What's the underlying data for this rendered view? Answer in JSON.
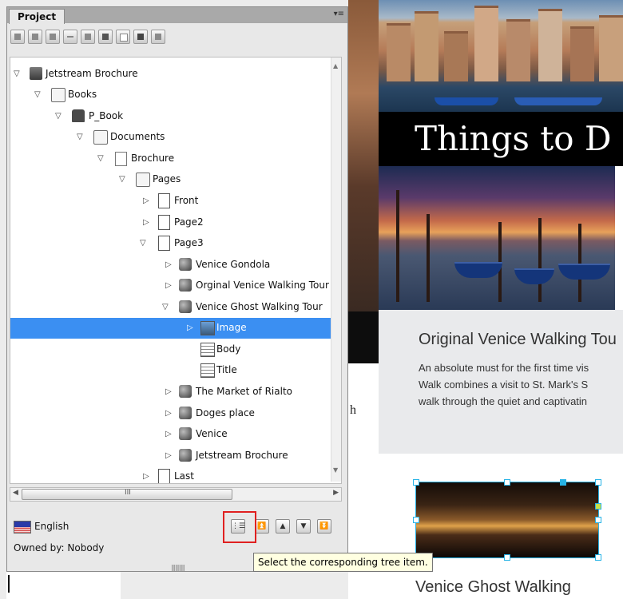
{
  "panel": {
    "tab_label": "Project",
    "menu_icon": "panel-menu-icon"
  },
  "toolbar": {
    "icons": [
      "file-icon",
      "save-icon",
      "checklist-icon",
      "add-icon",
      "copy-icon",
      "delete-icon",
      "blank-page-icon",
      "image-panel-icon",
      "settings-icon"
    ]
  },
  "tree": {
    "items": [
      {
        "label": "Jetstream Brochure",
        "icon": "book-icon",
        "toggle": "expanded"
      },
      {
        "label": "Books",
        "icon": "folder-icon",
        "toggle": "expanded"
      },
      {
        "label": "P_Book",
        "icon": "publication-book-icon",
        "toggle": "expanded"
      },
      {
        "label": "Documents",
        "icon": "folder-icon",
        "toggle": "expanded"
      },
      {
        "label": "Brochure",
        "icon": "document-icon",
        "toggle": "expanded"
      },
      {
        "label": "Pages",
        "icon": "folder-icon",
        "toggle": "expanded"
      },
      {
        "label": "Front",
        "icon": "page-icon",
        "toggle": "collapsed"
      },
      {
        "label": "Page2",
        "icon": "page-icon",
        "toggle": "collapsed"
      },
      {
        "label": "Page3",
        "icon": "page-icon",
        "toggle": "expanded"
      },
      {
        "label": "Venice Gondola",
        "icon": "component-icon",
        "toggle": "collapsed"
      },
      {
        "label": "Orginal Venice Walking Tour",
        "icon": "component-icon",
        "toggle": "collapsed"
      },
      {
        "label": "Venice Ghost Walking Tour",
        "icon": "component-icon",
        "toggle": "expanded"
      },
      {
        "label": "Image",
        "icon": "image-frame-icon",
        "toggle": "collapsed",
        "selected": true
      },
      {
        "label": "Body",
        "icon": "text-frame-icon",
        "toggle": "none"
      },
      {
        "label": "Title",
        "icon": "text-frame-icon",
        "toggle": "none"
      },
      {
        "label": "The Market of Rialto",
        "icon": "component-icon",
        "toggle": "collapsed"
      },
      {
        "label": "Doges place",
        "icon": "component-icon",
        "toggle": "collapsed"
      },
      {
        "label": "Venice",
        "icon": "component-icon",
        "toggle": "collapsed"
      },
      {
        "label": "Jetstream Brochure",
        "icon": "component-icon",
        "toggle": "collapsed"
      },
      {
        "label": "Last",
        "icon": "page-icon",
        "toggle": "collapsed"
      }
    ]
  },
  "scrollbar": {
    "grip": "III"
  },
  "footer": {
    "language": "English",
    "owned_by": "Owned by: Nobody",
    "tooltip": "Select the corresponding tree item."
  },
  "document": {
    "banner_title": "Things to D",
    "section_heading": "Original Venice Walking Tou",
    "body_lines": [
      "An absolute must for the first time vis",
      "Walk combines a visit to St. Mark's S",
      "walk through the quiet and captivatin"
    ],
    "second_heading": "Venice Ghost Walking",
    "left_fragment": "h",
    "selection_color": "#27b3e6"
  },
  "colors": {
    "tree_selection": "#3b8ff2",
    "highlight_box": "#e02020"
  }
}
